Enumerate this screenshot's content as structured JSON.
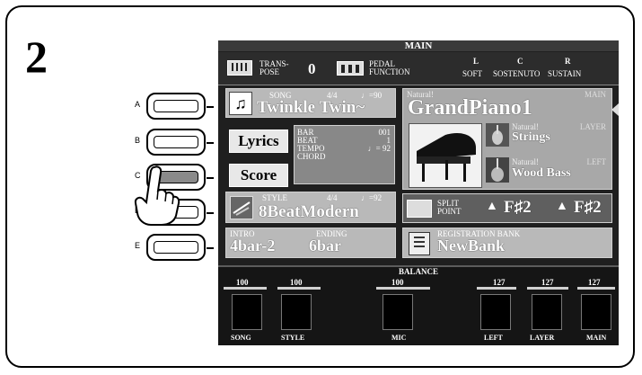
{
  "step_number": "2",
  "side_buttons": [
    {
      "letter": "A",
      "pressed": false
    },
    {
      "letter": "B",
      "pressed": false
    },
    {
      "letter": "C",
      "pressed": true
    },
    {
      "letter": "D",
      "pressed": false
    },
    {
      "letter": "E",
      "pressed": false
    }
  ],
  "screen": {
    "title": "MAIN",
    "transpose": {
      "label_line1": "TRANS-",
      "label_line2": "POSE",
      "value": "0"
    },
    "pedal": {
      "label_line1": "PEDAL",
      "label_line2": "FUNCTION"
    },
    "pedal_assign": {
      "soft_letter": "L",
      "soft_label": "SOFT",
      "sostenuto_letter": "C",
      "sostenuto_label": "SOSTENUTO",
      "sustain_letter": "R",
      "sustain_label": "SUSTAIN"
    },
    "song": {
      "label": "SONG",
      "time_sig": "4/4",
      "tempo": "♩=90",
      "name": "Twinkle Twin~"
    },
    "lyrics_button": "Lyrics",
    "score_button": "Score",
    "song_info": {
      "bar_label": "BAR",
      "bar_value": "001",
      "beat_label": "BEAT",
      "beat_value": "1",
      "tempo_label": "TEMPO",
      "tempo_value": "♩= 92",
      "chord_label": "CHORD"
    },
    "voice_main": {
      "category": "Natural!",
      "part": "MAIN",
      "name": "GrandPiano1"
    },
    "voice_layer": {
      "category": "Natural!",
      "part": "LAYER",
      "name": "Strings"
    },
    "voice_left": {
      "category": "Natural!",
      "part": "LEFT",
      "name": "Wood Bass"
    },
    "style": {
      "label": "STYLE",
      "time_sig": "4/4",
      "tempo": "♩=92",
      "name": "8BeatModern"
    },
    "split_point": {
      "label_line1": "SPLIT",
      "label_line2": "POINT",
      "left_value": "F♯2",
      "right_value": "F♯2"
    },
    "intro": {
      "label": "INTRO",
      "value": "4bar-2"
    },
    "ending": {
      "label": "ENDING",
      "value": "6bar"
    },
    "registration": {
      "label": "REGISTRATION BANK",
      "name": "NewBank"
    },
    "balance": {
      "title": "BALANCE",
      "channels": [
        {
          "label": "SONG",
          "value": "100",
          "level": 100
        },
        {
          "label": "STYLE",
          "value": "100",
          "level": 100
        },
        {
          "label": "MIC",
          "value": "100",
          "level": 100
        },
        {
          "label": "LEFT",
          "value": "127",
          "level": 127
        },
        {
          "label": "LAYER",
          "value": "127",
          "level": 127
        },
        {
          "label": "MAIN",
          "value": "127",
          "level": 127
        }
      ]
    }
  }
}
